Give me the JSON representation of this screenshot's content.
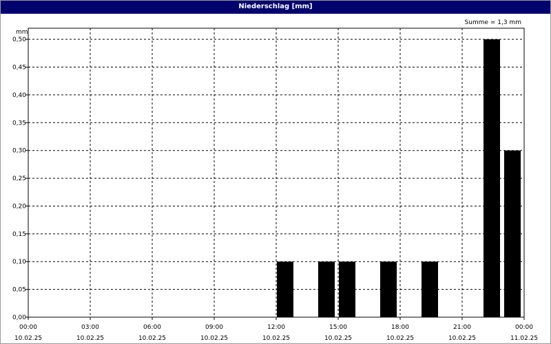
{
  "window": {
    "title": "Niederschlag [mm]"
  },
  "chart_data": {
    "type": "bar",
    "title": "Niederschlag [mm]",
    "ylabel": "mm",
    "xlabel": "",
    "annotation": "Summe = 1,3 mm",
    "ylim": [
      0,
      0.52
    ],
    "y_ticks": [
      "0,00",
      "0,05",
      "0,10",
      "0,15",
      "0,20",
      "0,25",
      "0,30",
      "0,35",
      "0,40",
      "0,45",
      "0,50"
    ],
    "y_tick_values": [
      0,
      0.05,
      0.1,
      0.15,
      0.2,
      0.25,
      0.3,
      0.35,
      0.4,
      0.45,
      0.5
    ],
    "x_ticks": [
      {
        "time": "00:00",
        "date": "10.02.25"
      },
      {
        "time": "03:00",
        "date": "10.02.25"
      },
      {
        "time": "06:00",
        "date": "10.02.25"
      },
      {
        "time": "09:00",
        "date": "10.02.25"
      },
      {
        "time": "12:00",
        "date": "10.02.25"
      },
      {
        "time": "15:00",
        "date": "10.02.25"
      },
      {
        "time": "18:00",
        "date": "10.02.25"
      },
      {
        "time": "21:00",
        "date": "10.02.25"
      },
      {
        "time": "00:00",
        "date": "11.02.25"
      }
    ],
    "x_start": "10.02.25 00:00",
    "x_end": "11.02.25 00:00",
    "bar_interval": "60 min",
    "x": [
      "10.02.25 12:00",
      "10.02.25 14:00",
      "10.02.25 15:00",
      "10.02.25 17:00",
      "10.02.25 19:00",
      "10.02.25 22:00",
      "10.02.25 23:00"
    ],
    "values": [
      0.1,
      0.1,
      0.1,
      0.1,
      0.1,
      0.5,
      0.3
    ],
    "grid": true,
    "bar_color": "#000000",
    "title_bar_color": "#02026f"
  }
}
